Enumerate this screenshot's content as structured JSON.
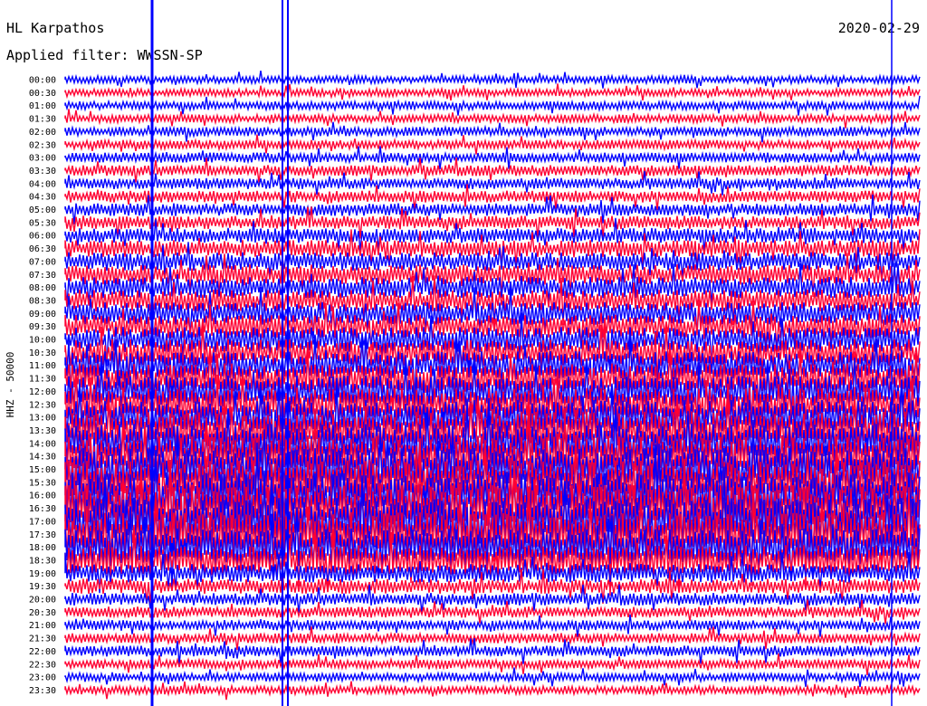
{
  "station": "HL Karpathos",
  "date": "2020-02-29",
  "filter_label": "Applied filter: WWSSN-SP",
  "chart_data": {
    "type": "line",
    "title": "HL Karpathos",
    "subtitle": "Applied filter: WWSSN-SP",
    "ylabel": "HHZ - 50000",
    "row_labels": [
      "00:00",
      "00:30",
      "01:00",
      "01:30",
      "02:00",
      "02:30",
      "03:00",
      "03:30",
      "04:00",
      "04:30",
      "05:00",
      "05:30",
      "06:00",
      "06:30",
      "07:00",
      "07:30",
      "08:00",
      "08:30",
      "09:00",
      "09:30",
      "10:00",
      "10:30",
      "11:00",
      "11:30",
      "12:00",
      "12:30",
      "13:00",
      "13:30",
      "14:00",
      "14:30",
      "15:00",
      "15:30",
      "16:00",
      "16:30",
      "17:00",
      "17:30",
      "18:00",
      "18:30",
      "19:00",
      "19:30",
      "20:00",
      "20:30",
      "21:00",
      "21:30",
      "22:00",
      "22:30",
      "23:00",
      "23:30"
    ],
    "row_colors": [
      "#0000ff",
      "#ff0033"
    ],
    "activity_level": [
      0.9,
      0.9,
      1.0,
      1.0,
      1.1,
      1.1,
      1.2,
      1.3,
      1.3,
      1.4,
      1.5,
      1.6,
      1.8,
      2.0,
      2.2,
      2.4,
      2.5,
      2.6,
      2.7,
      2.8,
      3.0,
      3.2,
      3.4,
      3.6,
      3.8,
      4.0,
      4.2,
      4.5,
      4.7,
      4.9,
      5.1,
      5.3,
      5.5,
      5.6,
      5.6,
      5.3,
      4.5,
      3.6,
      2.2,
      1.8,
      1.5,
      1.3,
      1.2,
      1.2,
      1.3,
      1.1,
      1.0,
      1.0
    ],
    "grid": false
  }
}
